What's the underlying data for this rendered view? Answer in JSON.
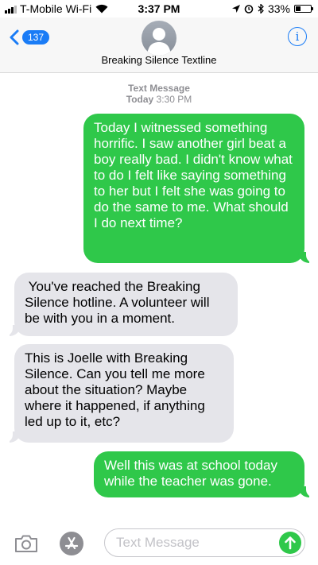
{
  "status_bar": {
    "carrier": "T-Mobile Wi-Fi",
    "time": "3:37 PM",
    "battery_percent": "33%",
    "battery_level": 0.33
  },
  "nav": {
    "back_count": "137",
    "contact_name": "Breaking Silence Textline",
    "info_label": "i"
  },
  "thread": {
    "service": "Text Message",
    "day": "Today",
    "time": "3:30 PM",
    "messages": [
      {
        "direction": "sent",
        "text": "Today I witnessed something horrific. I saw another girl beat a boy really bad. I didn't know what to do I felt like saying something to her but I felt she was going to do the same to me. What should I do next time?"
      },
      {
        "direction": "received",
        "text": " You've reached the Breaking Silence hotline. A volunteer will be with you in a moment."
      },
      {
        "direction": "received",
        "text": "This is Joelle with Breaking Silence. Can you tell me more about the situation? Maybe where it happened, if anything led up to it, etc?"
      },
      {
        "direction": "sent",
        "text": "Well this was at school today while the teacher was gone."
      }
    ]
  },
  "composer": {
    "placeholder": "Text Message",
    "value": ""
  },
  "colors": {
    "sent_bubble": "#2fc84a",
    "received_bubble": "#e5e5ea",
    "accent": "#1a7cf6"
  }
}
